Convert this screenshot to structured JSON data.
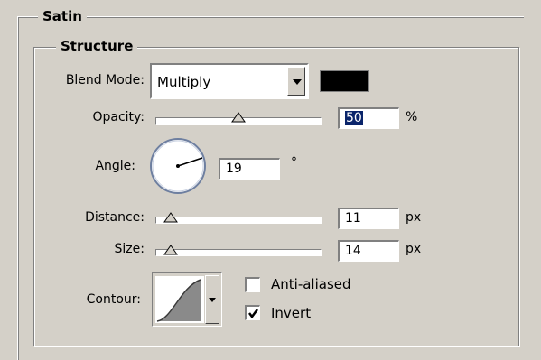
{
  "satin": {
    "title": "Satin"
  },
  "structure": {
    "title": "Structure",
    "blend_mode": {
      "label": "Blend Mode:",
      "value": "Multiply",
      "color": "#000000"
    },
    "opacity": {
      "label": "Opacity:",
      "value": "50",
      "unit": "%",
      "level": 0.5
    },
    "angle": {
      "label": "Angle:",
      "value": "19",
      "unit": "°"
    },
    "distance": {
      "label": "Distance:",
      "value": "11",
      "unit": "px",
      "level": 0.06
    },
    "size": {
      "label": "Size:",
      "value": "14",
      "unit": "px",
      "level": 0.06
    },
    "contour": {
      "label": "Contour:"
    },
    "anti_aliased": {
      "label": "Anti-aliased",
      "checked": false
    },
    "invert": {
      "label": "Invert",
      "checked": true
    }
  }
}
